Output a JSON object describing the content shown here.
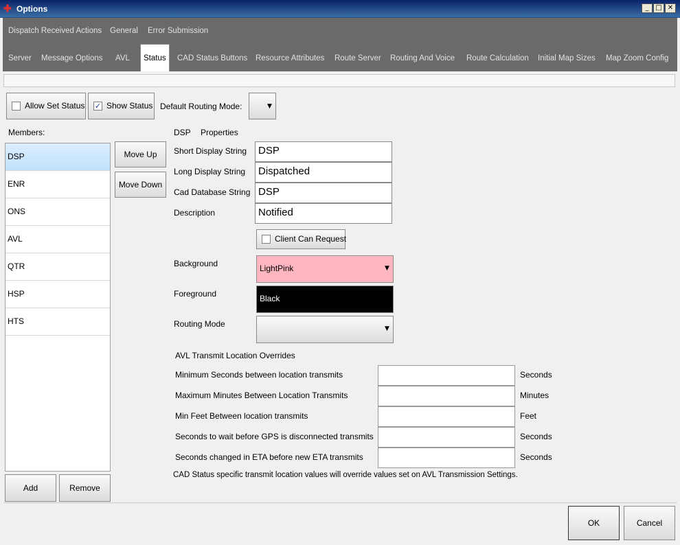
{
  "window": {
    "title": "Options"
  },
  "tabs_row1": [
    "Dispatch Received Actions",
    "General",
    "Error Submission"
  ],
  "tabs_row2": [
    "Server",
    "Message Options",
    "AVL",
    "Status",
    "CAD Status Buttons",
    "Resource Attributes",
    "Route Server",
    "Routing And Voice",
    "Route Calculation",
    "Initial Map Sizes",
    "Map Zoom Config"
  ],
  "active_tab": "Status",
  "toolbar": {
    "allow_set_status_label": "Allow Set Status",
    "allow_set_status_checked": false,
    "show_status_label": "Show Status",
    "show_status_checked": true,
    "default_routing_mode_label": "Default Routing Mode:",
    "default_routing_mode_value": ""
  },
  "members": {
    "label": "Members:",
    "items": [
      "DSP",
      "ENR",
      "ONS",
      "AVL",
      "QTR",
      "HSP",
      "HTS"
    ],
    "selected": "DSP",
    "move_up_label": "Move Up",
    "move_down_label": "Move Down",
    "add_label": "Add",
    "remove_label": "Remove"
  },
  "properties": {
    "header_code": "DSP",
    "header_label": "Properties",
    "short_display_label": "Short Display String",
    "short_display_value": "DSP",
    "long_display_label": "Long Display String",
    "long_display_value": "Dispatched",
    "cad_db_label": "Cad Database String",
    "cad_db_value": "DSP",
    "description_label": "Description",
    "description_value": "Notified",
    "client_can_request_label": "Client Can Request",
    "client_can_request_checked": false,
    "background_label": "Background",
    "background_value": "LightPink",
    "background_color": "#ffb6c1",
    "foreground_label": "Foreground",
    "foreground_value": "Black",
    "foreground_color": "#000000",
    "routing_mode_label": "Routing Mode",
    "routing_mode_value": ""
  },
  "avl": {
    "title": "AVL Transmit Location Overrides",
    "rows": [
      {
        "label": "Minimum Seconds between location transmits",
        "value": "",
        "unit": "Seconds"
      },
      {
        "label": "Maximum Minutes Between Location Transmits",
        "value": "",
        "unit": "Minutes"
      },
      {
        "label": "Min Feet Between location transmits",
        "value": "",
        "unit": "Feet"
      },
      {
        "label": "Seconds to wait before GPS is disconnected transmits",
        "value": "",
        "unit": "Seconds"
      },
      {
        "label": "Seconds changed in ETA before new ETA transmits",
        "value": "",
        "unit": "Seconds"
      }
    ],
    "note": "CAD Status specific transmit location values will override values set on AVL Transmission Settings."
  },
  "footer": {
    "ok_label": "OK",
    "cancel_label": "Cancel"
  }
}
